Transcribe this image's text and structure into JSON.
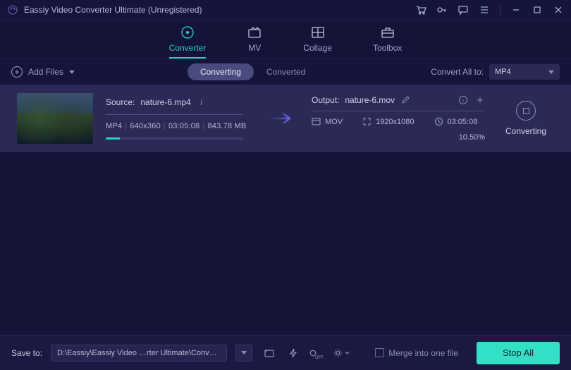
{
  "title": "Eassiy Video Converter Ultimate (Unregistered)",
  "nav": {
    "converter": "Converter",
    "mv": "MV",
    "collage": "Collage",
    "toolbox": "Toolbox"
  },
  "secondbar": {
    "add_files": "Add Files",
    "seg_converting": "Converting",
    "seg_converted": "Converted",
    "convert_all_label": "Convert All to:",
    "convert_all_value": "MP4"
  },
  "task": {
    "source_prefix": "Source:",
    "source_file": "nature-6.mp4",
    "src_format": "MP4",
    "src_resolution": "640x360",
    "src_duration": "03:05:08",
    "src_size": "843.78 MB",
    "output_prefix": "Output:",
    "output_file": "nature-6.mov",
    "out_format": "MOV",
    "out_resolution": "1920x1080",
    "out_duration": "03:05:08",
    "percent": "10.50%",
    "progress_width": "10.5%",
    "action_label": "Converting"
  },
  "bottom": {
    "saveto": "Save to:",
    "path": "D:\\Eassiy\\Eassiy Video …rter Ultimate\\Converted",
    "merge": "Merge into one file",
    "stopall": "Stop All"
  }
}
